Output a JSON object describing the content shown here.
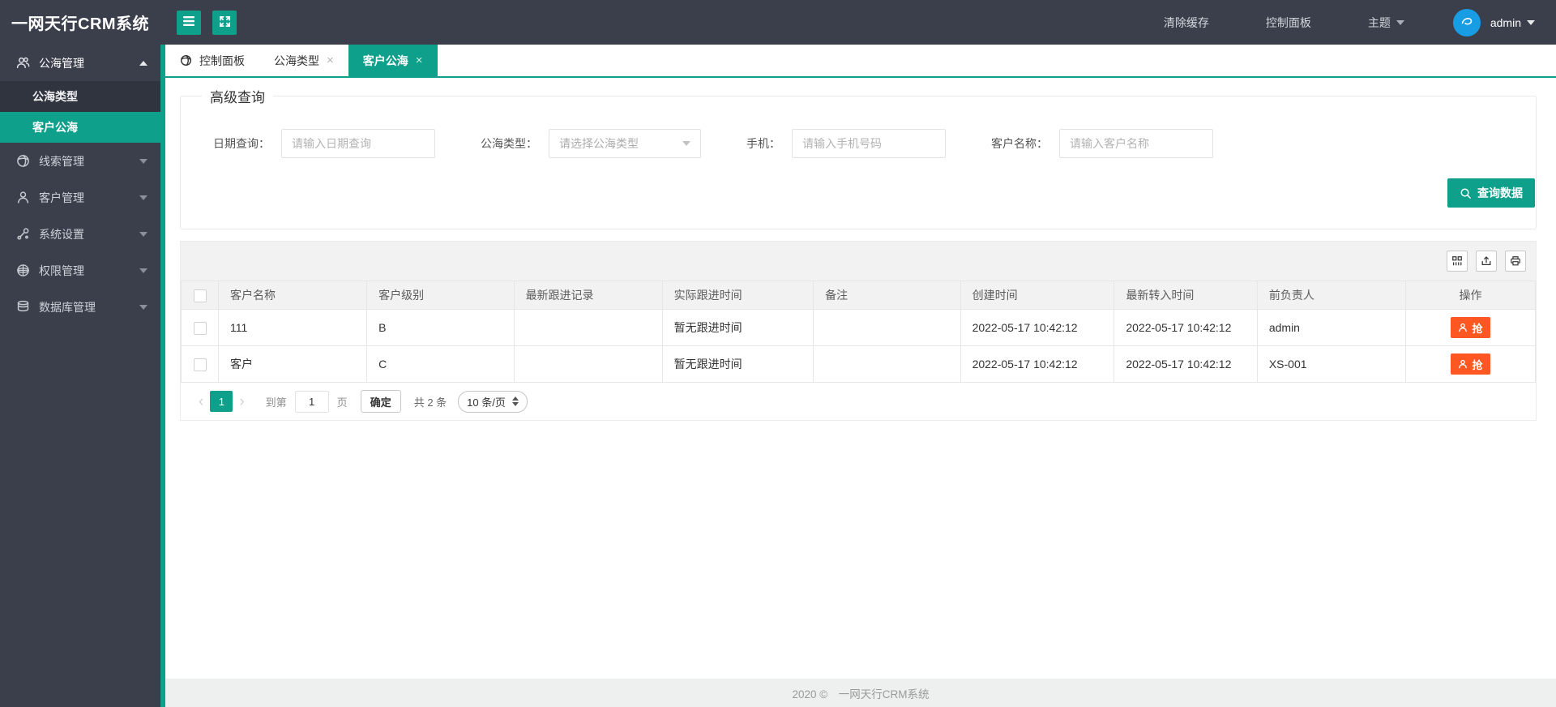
{
  "topbar": {
    "logo": "一网天行CRM系统",
    "clear_cache": "清除缓存",
    "control_panel": "控制面板",
    "theme": "主题",
    "username": "admin"
  },
  "sidebar": {
    "groups": [
      {
        "label": "公海管理",
        "icon": "users-icon",
        "expanded": true,
        "children": [
          {
            "label": "公海类型",
            "active": false
          },
          {
            "label": "客户公海",
            "active": true
          }
        ]
      },
      {
        "label": "线索管理",
        "icon": "globe-icon"
      },
      {
        "label": "客户管理",
        "icon": "user-icon"
      },
      {
        "label": "系统设置",
        "icon": "settings-icon"
      },
      {
        "label": "权限管理",
        "icon": "sphere-icon"
      },
      {
        "label": "数据库管理",
        "icon": "database-icon"
      }
    ]
  },
  "tabs": [
    {
      "label": "控制面板",
      "closable": false,
      "active": false
    },
    {
      "label": "公海类型",
      "closable": true,
      "active": false
    },
    {
      "label": "客户公海",
      "closable": true,
      "active": true
    }
  ],
  "query": {
    "legend": "高级查询",
    "fields": [
      {
        "label": "日期查询：",
        "placeholder": "请输入日期查询",
        "type": "text"
      },
      {
        "label": "公海类型：",
        "placeholder": "请选择公海类型",
        "type": "select"
      },
      {
        "label": "手机：",
        "placeholder": "请输入手机号码",
        "type": "text"
      },
      {
        "label": "客户名称：",
        "placeholder": "请输入客户名称",
        "type": "text"
      }
    ],
    "submit": "查询数据"
  },
  "table": {
    "columns": [
      "客户名称",
      "客户级别",
      "最新跟进记录",
      "实际跟进时间",
      "备注",
      "创建时间",
      "最新转入时间",
      "前负责人",
      "操作"
    ],
    "rows": [
      {
        "cells": [
          "111",
          "B",
          "",
          "暂无跟进时间",
          "",
          "2022-05-17 10:42:12",
          "2022-05-17 10:42:12",
          "admin"
        ],
        "action": "抢"
      },
      {
        "cells": [
          "客户",
          "C",
          "",
          "暂无跟进时间",
          "",
          "2022-05-17 10:42:12",
          "2022-05-17 10:42:12",
          "XS-001"
        ],
        "action": "抢"
      }
    ]
  },
  "pagination": {
    "page": "1",
    "goto_label": "到第",
    "goto_value": "1",
    "page_label": "页",
    "confirm": "确定",
    "total": "共 2 条",
    "page_size": "10 条/页"
  },
  "footer": {
    "text": "2020 ©　一网天行CRM系统"
  },
  "glyphs": {
    "close": "×",
    "prev": "‹",
    "next": "›"
  },
  "colors": {
    "accent": "#0fa08c",
    "danger": "#ff5722",
    "dark": "#3a3f4b",
    "avatar_blue": "#189de4"
  }
}
